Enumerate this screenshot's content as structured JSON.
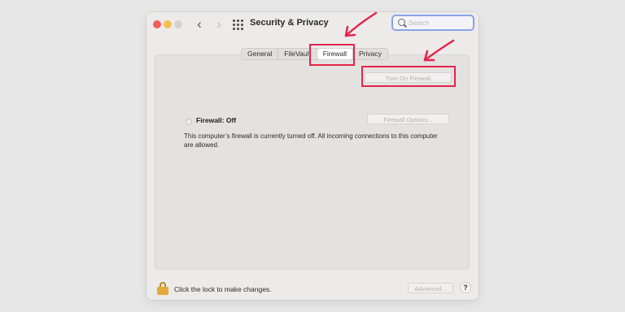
{
  "window": {
    "title": "Security & Privacy",
    "nav": {
      "back_icon": "‹",
      "forward_icon": "›"
    },
    "search": {
      "placeholder": "Search",
      "value": ""
    }
  },
  "tabs": [
    {
      "label": "General"
    },
    {
      "label": "FileVault"
    },
    {
      "label": "Firewall",
      "selected": true
    },
    {
      "label": "Privacy"
    }
  ],
  "firewall": {
    "status": "Firewall: Off",
    "description": "This computer’s firewall is currently turned off. All incoming connections to this computer are allowed.",
    "turn_on_button": "Turn On Firewall",
    "options_button": "Firewall Options..."
  },
  "footer": {
    "lock_text": "Click the lock to make changes.",
    "advanced_button": "Advanced...",
    "help_label": "?"
  },
  "colors": {
    "annotation": "#e3244a",
    "search_focus": "#8aa3e6",
    "lock": "#e2a93b"
  },
  "icons": [
    "back-icon",
    "forward-icon",
    "grid-icon",
    "search-icon",
    "lock-icon",
    "help-icon"
  ]
}
